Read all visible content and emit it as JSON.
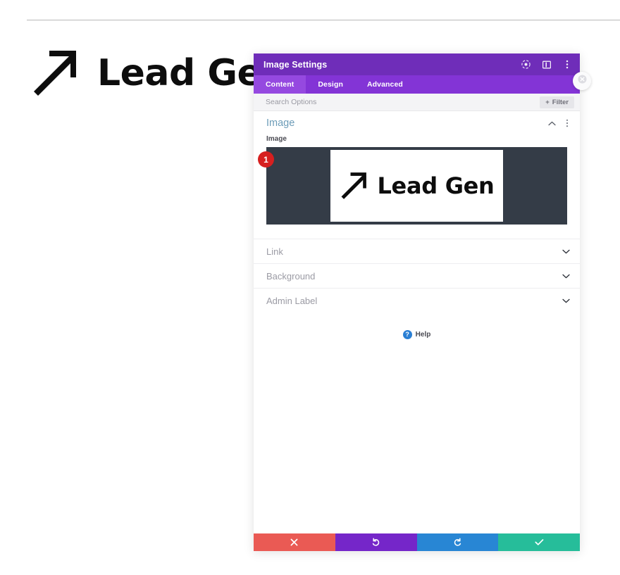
{
  "page": {
    "logo": {
      "icon": "diagonal-arrow-up-right",
      "text": "Lead Gen"
    }
  },
  "modal": {
    "title": "Image Settings",
    "header_icons": [
      {
        "name": "fullscreen-icon",
        "title": "Fullscreen"
      },
      {
        "name": "layout-columns-icon",
        "title": "Layout"
      },
      {
        "name": "more-vertical-icon",
        "title": "More"
      }
    ],
    "close_icon": "close-icon",
    "tabs": [
      {
        "label": "Content",
        "active": true
      },
      {
        "label": "Design",
        "active": false
      },
      {
        "label": "Advanced",
        "active": false
      }
    ],
    "search": {
      "placeholder": "Search Options",
      "value": ""
    },
    "filter_button": {
      "label": "Filter",
      "icon": "plus-icon"
    },
    "sections": {
      "image": {
        "title": "Image",
        "collapse_icon": "chevron-up-icon",
        "menu_icon": "more-vertical-icon",
        "field_label": "Image",
        "badge": "1",
        "preview": {
          "icon": "diagonal-arrow-up-right",
          "text": "Lead Gen",
          "background": "#343c47"
        }
      },
      "collapsed": [
        {
          "title": "Link",
          "icon": "chevron-down-icon"
        },
        {
          "title": "Background",
          "icon": "chevron-down-icon"
        },
        {
          "title": "Admin Label",
          "icon": "chevron-down-icon"
        }
      ]
    },
    "help": {
      "icon": "question-circle-icon",
      "label": "Help"
    },
    "footer_buttons": [
      {
        "name": "cancel",
        "icon": "close-icon",
        "color": "#ea5a54"
      },
      {
        "name": "undo",
        "icon": "undo-icon",
        "color": "#7526c9"
      },
      {
        "name": "redo",
        "icon": "redo-icon",
        "color": "#2886d4"
      },
      {
        "name": "save",
        "icon": "check-icon",
        "color": "#26bd9a"
      }
    ]
  },
  "colors": {
    "header_purple": "#6f2db9",
    "tab_purple": "#8334d6",
    "tab_active_purple": "#9549e0",
    "section_title_blue": "#6c9cb8",
    "badge_red": "#d61f1f",
    "help_blue": "#2a7fd4"
  }
}
